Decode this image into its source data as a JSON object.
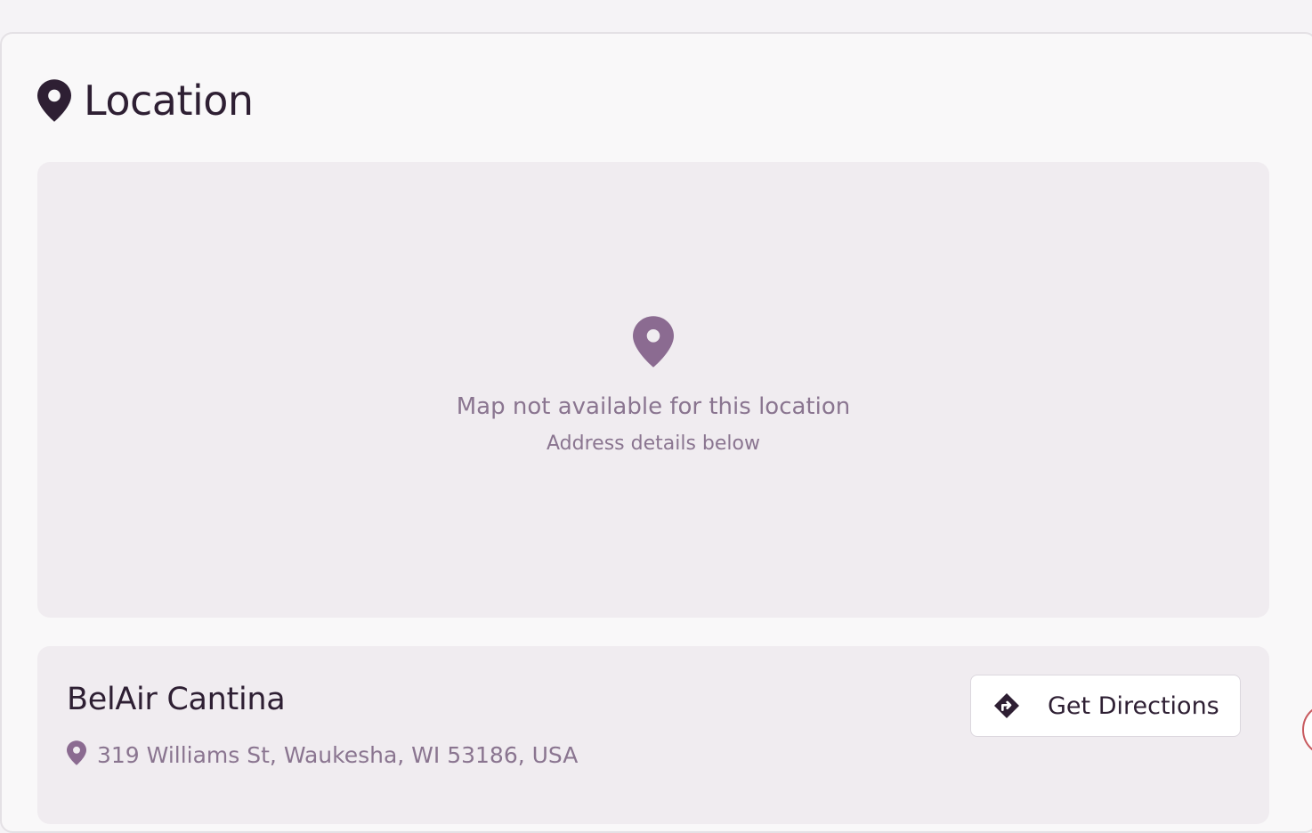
{
  "section": {
    "title": "Location",
    "icon": "map-pin-icon"
  },
  "map": {
    "message": "Map not available for this location",
    "sub_message": "Address details below",
    "icon": "map-pin-icon"
  },
  "venue": {
    "name": "BelAir Cantina",
    "address": "319 Williams St, Waukesha, WI 53186, USA",
    "address_icon": "map-pin-icon"
  },
  "directions_button": {
    "label": "Get Directions",
    "icon": "directions-icon"
  },
  "colors": {
    "primary_text": "#2e1f33",
    "muted_text": "#8a7590",
    "panel_bg": "#f0ecf0",
    "accent_edge": "#c85a5f"
  }
}
